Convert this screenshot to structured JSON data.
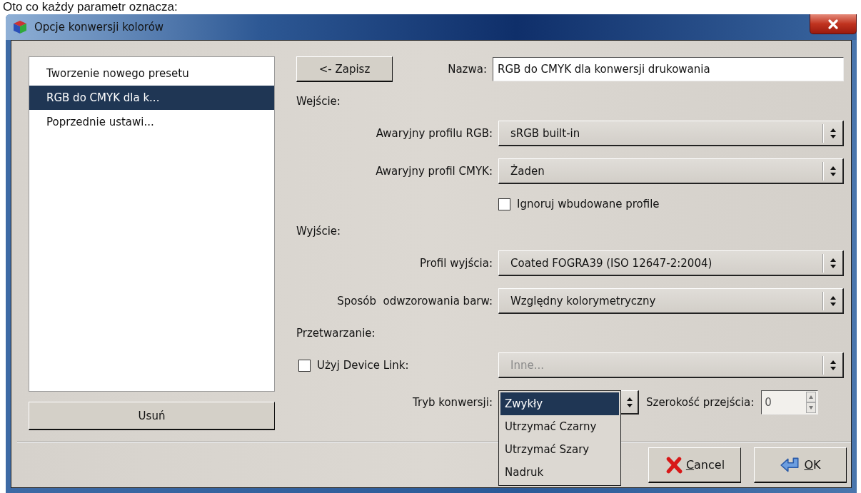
{
  "caption": "Oto co każdy parametr oznacza:",
  "window": {
    "title": "Opcje konwersji kolorów"
  },
  "presets": [
    {
      "label": "Tworzenie nowego presetu",
      "selected": false
    },
    {
      "label": "RGB do CMYK dla k...",
      "selected": true
    },
    {
      "label": "Poprzednie ustawi...",
      "selected": false
    }
  ],
  "delete_button": "Usuń",
  "save_button": "<- Zapisz",
  "name_field": {
    "label": "Nazwa:",
    "value": "RGB do CMYK dla konwersji drukowania"
  },
  "form": [
    {
      "kind": "heading",
      "label": "Wejście:"
    },
    {
      "kind": "combo",
      "label": "Awaryjny profilu RGB:",
      "value": "sRGB built-in",
      "disabled": false
    },
    {
      "kind": "combo",
      "label": "Awaryjny profil CMYK:",
      "value": "Żaden",
      "disabled": false
    },
    {
      "kind": "checkbox",
      "label": "Ignoruj wbudowane profile",
      "checked": false
    },
    {
      "kind": "heading",
      "label": "Wyjście:"
    },
    {
      "kind": "combo",
      "label": "Profil wyjścia:",
      "value": "Coated FOGRA39 (ISO 12647-2:2004)",
      "disabled": false
    },
    {
      "kind": "combo",
      "label": "Sposób  odwzorowania barw:",
      "value": "Względny kolorymetryczny",
      "disabled": false
    },
    {
      "kind": "heading",
      "label": "Przetwarzanie:"
    },
    {
      "kind": "checkcombo",
      "label": "Użyj Device Link:",
      "checked": false,
      "value": "Inne...",
      "disabled": true
    }
  ],
  "conversion": {
    "label": "Tryb konwersji:",
    "options": [
      {
        "label": "Zwykły",
        "selected": true
      },
      {
        "label": "Utrzymać Czarny",
        "selected": false
      },
      {
        "label": "Utrzymać Szary",
        "selected": false
      },
      {
        "label": "Nadruk",
        "selected": false
      }
    ],
    "width_label": "Szerokość przejścia:",
    "width_value": "0"
  },
  "buttons": [
    {
      "kind": "cancel",
      "label": "Cancel"
    },
    {
      "kind": "ok",
      "label": "OK"
    }
  ]
}
